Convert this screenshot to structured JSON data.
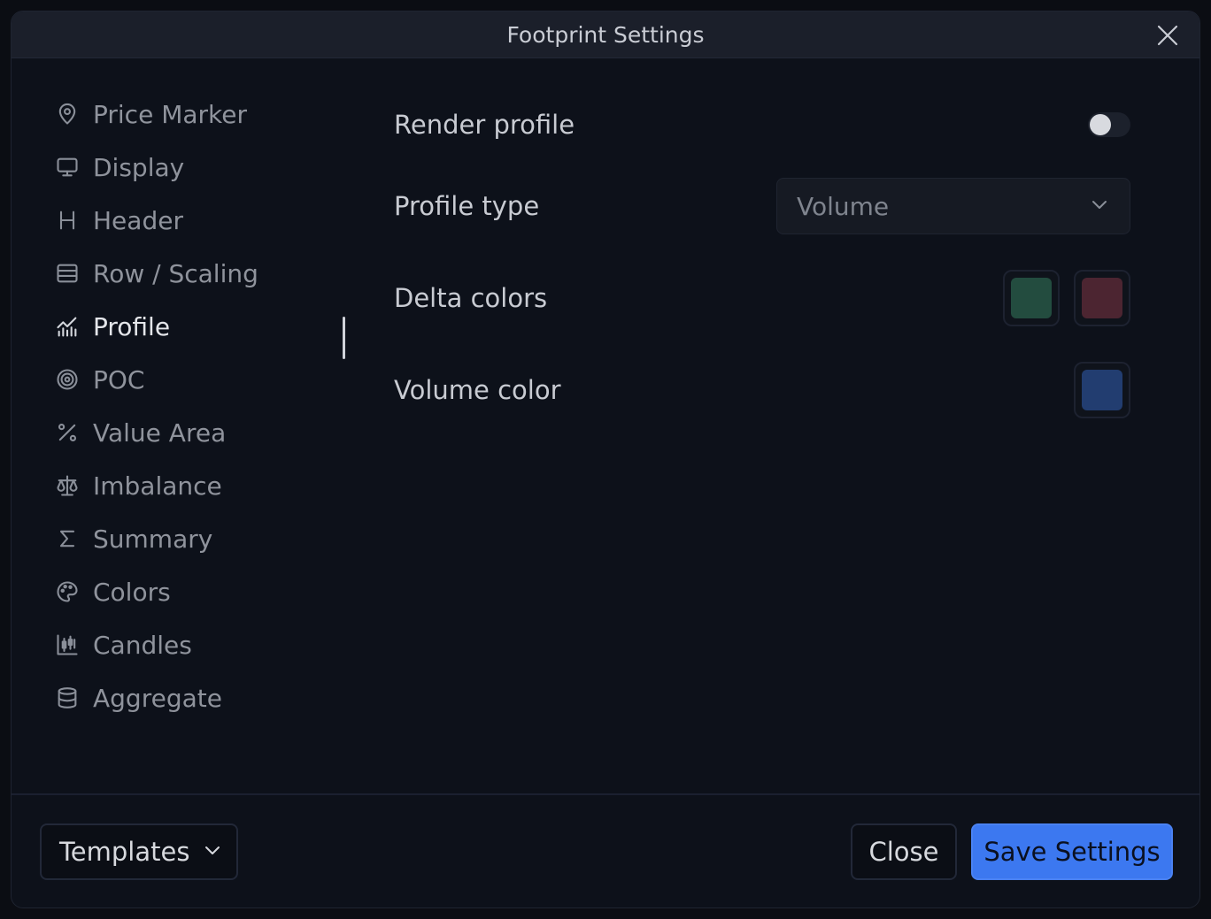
{
  "window": {
    "title": "Footprint Settings"
  },
  "sidebar": {
    "items": [
      {
        "label": "Price Marker",
        "icon": "map-pin-icon",
        "active": false
      },
      {
        "label": "Display",
        "icon": "monitor-icon",
        "active": false
      },
      {
        "label": "Header",
        "icon": "heading-icon",
        "active": false
      },
      {
        "label": "Row / Scaling",
        "icon": "rows-icon",
        "active": false
      },
      {
        "label": "Profile",
        "icon": "chart-profile-icon",
        "active": true
      },
      {
        "label": "POC",
        "icon": "target-icon",
        "active": false
      },
      {
        "label": "Value Area",
        "icon": "percent-icon",
        "active": false
      },
      {
        "label": "Imbalance",
        "icon": "scale-icon",
        "active": false
      },
      {
        "label": "Summary",
        "icon": "sigma-icon",
        "active": false
      },
      {
        "label": "Colors",
        "icon": "palette-icon",
        "active": false
      },
      {
        "label": "Candles",
        "icon": "candlestick-icon",
        "active": false
      },
      {
        "label": "Aggregate",
        "icon": "database-icon",
        "active": false
      }
    ]
  },
  "profile": {
    "render_profile": {
      "label": "Render profile",
      "enabled": false
    },
    "profile_type": {
      "label": "Profile type",
      "value": "Volume"
    },
    "delta_colors": {
      "label": "Delta colors",
      "positive": "#234c3f",
      "negative": "#4c2531"
    },
    "volume_color": {
      "label": "Volume color",
      "color": "#223d70"
    }
  },
  "footer": {
    "templates_label": "Templates",
    "close_label": "Close",
    "save_label": "Save Settings"
  },
  "colors": {
    "accent": "#3c78f0"
  }
}
